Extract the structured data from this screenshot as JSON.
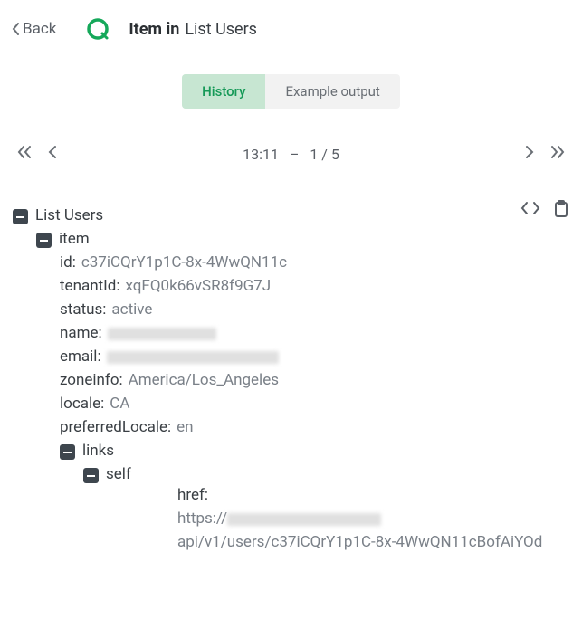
{
  "header": {
    "back_label": "Back",
    "title_bold": "Item in",
    "title_light": "List Users"
  },
  "tabs": {
    "history": "History",
    "example": "Example output"
  },
  "pager": {
    "time": "13:11",
    "sep": "–",
    "position": "1 / 5"
  },
  "tree": {
    "root": "List Users",
    "item_label": "item",
    "fields": {
      "id_key": "id:",
      "id_val": "c37iCQrY1p1C-8x-4WwQN11c",
      "tenant_key": "tenantId:",
      "tenant_val": "xqFQ0k66vSR8f9G7J",
      "status_key": "status:",
      "status_val": "active",
      "name_key": "name:",
      "email_key": "email:",
      "zone_key": "zoneinfo:",
      "zone_val": "America/Los_Angeles",
      "locale_key": "locale:",
      "locale_val": "CA",
      "pref_key": "preferredLocale:",
      "pref_val": "en"
    },
    "links_label": "links",
    "self_label": "self",
    "href_key": "href:",
    "href_prefix": "https://",
    "href_suffix": "api/v1/users/c37iCQrY1p1C-8x-4WwQN11cBofAiYOd"
  }
}
